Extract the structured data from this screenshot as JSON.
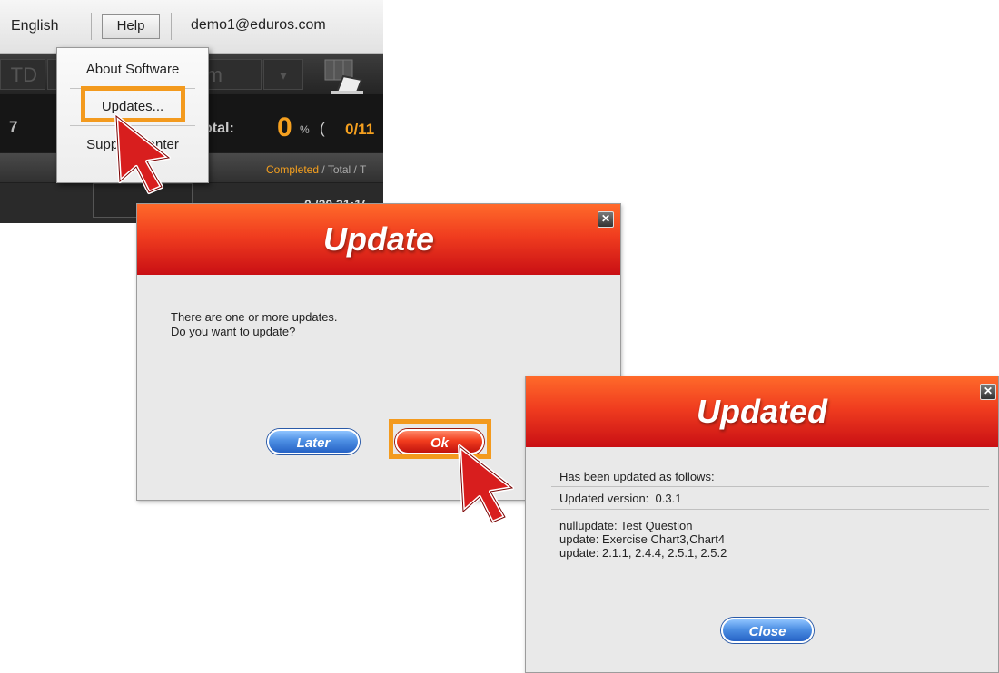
{
  "menubar": {
    "language": "English",
    "help": "Help",
    "user_email": "demo1@eduros.com"
  },
  "toolbar": {
    "seg1_text": "TD",
    "seg2_text": "m",
    "seg3_text": "▾"
  },
  "stats": {
    "left_number": "7",
    "total_label": "otal:",
    "percent_value": "0",
    "percent_sign": "%",
    "paren": "(",
    "count": "0/11"
  },
  "column_header": {
    "completed": "Completed",
    "rest": " / Total / T"
  },
  "row": {
    "text": "0 /20  31:1("
  },
  "help_menu": {
    "items": [
      {
        "label": "About Software"
      },
      {
        "label": "Updates..."
      },
      {
        "label": "Support Center"
      }
    ]
  },
  "update_dialog": {
    "title": "Update",
    "close_glyph": "✕",
    "message_line1": "There are one or more updates.",
    "message_line2": "Do you want to update?",
    "later_label": "Later",
    "ok_label": "Ok"
  },
  "updated_dialog": {
    "title": "Updated",
    "close_glyph": "✕",
    "intro": "Has been updated as follows:",
    "version_label": "Updated version:",
    "version_value": "0.3.1",
    "notes": [
      "nullupdate: Test Question",
      "update: Exercise Chart3,Chart4",
      "update: 2.1.1, 2.4.4, 2.5.1, 2.5.2"
    ],
    "close_label": "Close"
  },
  "colors": {
    "highlight": "#f39a1e",
    "header_red": "#e8301c",
    "accent_orange": "#f5a01f",
    "button_blue": "#3b7ad6"
  }
}
